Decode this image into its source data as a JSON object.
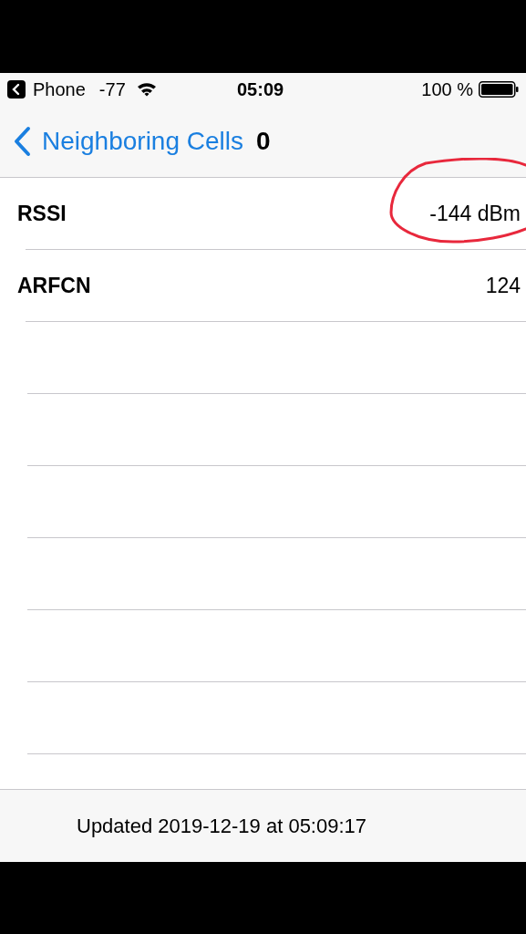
{
  "status_bar": {
    "back_app": "Phone",
    "signal": "-77",
    "time": "05:09",
    "battery": "100 %"
  },
  "nav_bar": {
    "back_label": "Neighboring Cells",
    "count": "0"
  },
  "rows": [
    {
      "label": "RSSI",
      "value": "-144 dBm",
      "circled": true
    },
    {
      "label": "ARFCN",
      "value": "124",
      "circled": false
    }
  ],
  "footer": {
    "text": "Updated 2019-12-19 at 05:09:17"
  }
}
